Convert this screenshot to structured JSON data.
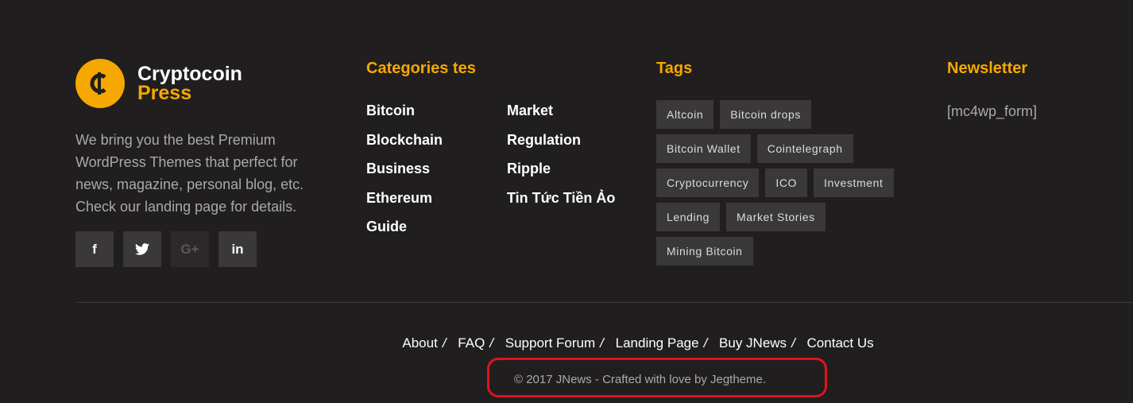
{
  "brand": {
    "line1": "Cryptocoin",
    "line2": "Press",
    "logo_icon": "cent-coin-icon",
    "accent": "#f5a800"
  },
  "about_text": "We bring you the best Premium WordPress Themes that perfect for news, magazine, personal blog, etc. Check our landing page for details.",
  "social": [
    {
      "name": "facebook-icon",
      "glyph": "f"
    },
    {
      "name": "twitter-icon",
      "glyph": "🐦"
    },
    {
      "name": "google-plus-icon",
      "glyph": "G+"
    },
    {
      "name": "linkedin-icon",
      "glyph": "in"
    }
  ],
  "categories": {
    "heading": "Categories tes",
    "col1": [
      "Bitcoin",
      "Blockchain",
      "Business",
      "Ethereum",
      "Guide"
    ],
    "col2": [
      "Market",
      "Regulation",
      "Ripple",
      "Tin Tức Tiền Ảo"
    ]
  },
  "tags": {
    "heading": "Tags",
    "rows": [
      [
        "Altcoin",
        "Bitcoin drops"
      ],
      [
        "Bitcoin Wallet",
        "Cointelegraph"
      ],
      [
        "Cryptocurrency",
        "ICO",
        "Investment"
      ],
      [
        "Lending",
        "Market Stories"
      ],
      [
        "Mining Bitcoin"
      ]
    ]
  },
  "newsletter": {
    "heading": "Newsletter",
    "text": "[mc4wp_form]"
  },
  "footer_nav": [
    "About",
    "FAQ",
    "Support Forum",
    "Landing Page",
    "Buy JNews",
    "Contact Us"
  ],
  "nav_separator": "/",
  "copyright": "© 2017 JNews - Crafted with love by Jegtheme."
}
